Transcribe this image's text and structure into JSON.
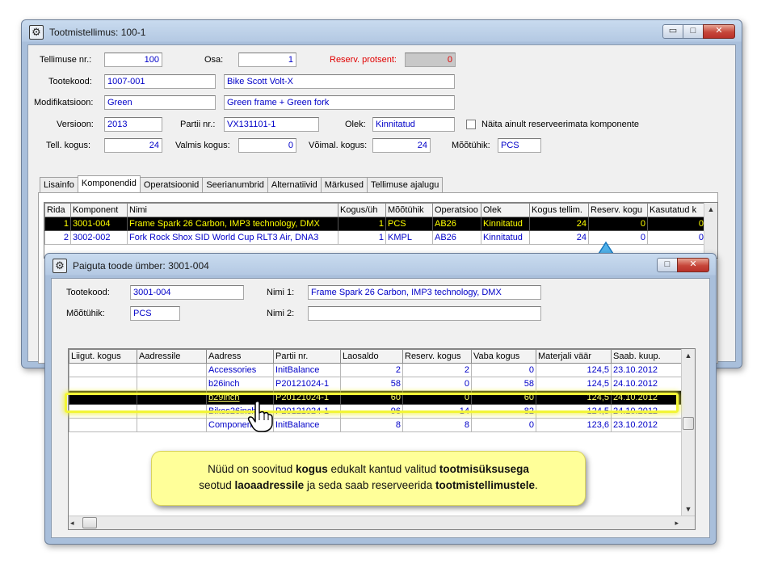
{
  "main_window": {
    "title": "Tootmistellimus: 100-1",
    "caption_buttons": {
      "minimize": "▭",
      "maximize": "□",
      "close": "✕"
    },
    "form": {
      "order_nr_label": "Tellimuse nr.:",
      "order_nr": "100",
      "part_label": "Osa:",
      "part": "1",
      "reserv_pct_label": "Reserv. protsent:",
      "reserv_pct": "0",
      "product_code_label": "Tootekood:",
      "product_code": "1007-001",
      "product_name": "Bike Scott Volt-X",
      "modification_label": "Modifikatsioon:",
      "modification": "Green",
      "modification_desc": "Green frame + Green fork",
      "version_label": "Versioon:",
      "version": "2013",
      "batch_label": "Partii nr.:",
      "batch": "VX131101-1",
      "status_label": "Olek:",
      "status": "Kinnitatud",
      "only_unreserved_label": "Näita ainult reserveerimata komponente",
      "ordered_qty_label": "Tell. kogus:",
      "ordered_qty": "24",
      "done_qty_label": "Valmis kogus:",
      "done_qty": "0",
      "possible_qty_label": "Võimal. kogus:",
      "possible_qty": "24",
      "unit_label": "Mõõtühik:",
      "unit": "PCS"
    },
    "tabs": [
      "Lisainfo",
      "Komponendid",
      "Operatsioonid",
      "Seerianumbrid",
      "Alternatiivid",
      "Märkused",
      "Tellimuse ajalugu"
    ],
    "active_tab": "Komponendid",
    "components_grid": {
      "columns": [
        "Rida",
        "Komponent",
        "Nimi",
        "Kogus/üh",
        "Mõõtühik",
        "Operatsioo",
        "Olek",
        "Kogus tellim.",
        "Reserv. kogu",
        "Kasutatud k"
      ],
      "rows": [
        [
          "1",
          "3001-004",
          "Frame Spark 26 Carbon, IMP3 technology, DMX",
          "1",
          "PCS",
          "AB26",
          "Kinnitatud",
          "24",
          "0",
          "0"
        ],
        [
          "2",
          "3002-002",
          "Fork Rock Shox SID World Cup RLT3 Air, DNA3",
          "1",
          "KMPL",
          "AB26",
          "Kinnitatud",
          "24",
          "0",
          "0"
        ]
      ]
    }
  },
  "dialog": {
    "title": "Paiguta toode ümber: 3001-004",
    "product_code_label": "Tootekood:",
    "product_code": "3001-004",
    "unit_label": "Mõõtühik:",
    "unit": "PCS",
    "name1_label": "Nimi 1:",
    "name1": "Frame Spark 26 Carbon, IMP3 technology, DMX",
    "name2_label": "Nimi 2:",
    "name2": "",
    "grid": {
      "columns": [
        "Liigut. kogus",
        "Aadressile",
        "Aadress",
        "Partii nr.",
        "Laosaldo",
        "Reserv. kogus",
        "Vaba kogus",
        "Materjali väär",
        "Saab. kuup."
      ],
      "rows": [
        [
          "",
          "",
          "Accessories",
          "InitBalance",
          "2",
          "2",
          "0",
          "124,5",
          "23.10.2012"
        ],
        [
          "",
          "",
          "b26inch",
          "P20121024-1",
          "58",
          "0",
          "58",
          "124,5",
          "24.10.2012"
        ],
        [
          "",
          "",
          "b29inch",
          "P20121024-1",
          "60",
          "0",
          "60",
          "124,5",
          "24.10.2012"
        ],
        [
          "",
          "",
          "Bikes26inch",
          "P20121024-1",
          "96",
          "14",
          "82",
          "124,5",
          "24.10.2012"
        ],
        [
          "",
          "",
          "Components",
          "InitBalance",
          "8",
          "8",
          "0",
          "123,6",
          "23.10.2012"
        ]
      ]
    }
  },
  "callout": {
    "p1": "Nüüd on soovitud ",
    "b1": "kogus",
    "p2": " edukalt kantud valitud ",
    "b2": "tootmisüksusega",
    "p3": "seotud ",
    "b3": "laoaadressile",
    "p4": " ja seda saab reserveerida ",
    "b4": "tootmistellimustele",
    "p5": "."
  },
  "colors": {
    "arrow": "#2aa0e6",
    "highlight": "#f2f536",
    "callout_bg": "#ffff99",
    "link_text": "#0000c8"
  }
}
